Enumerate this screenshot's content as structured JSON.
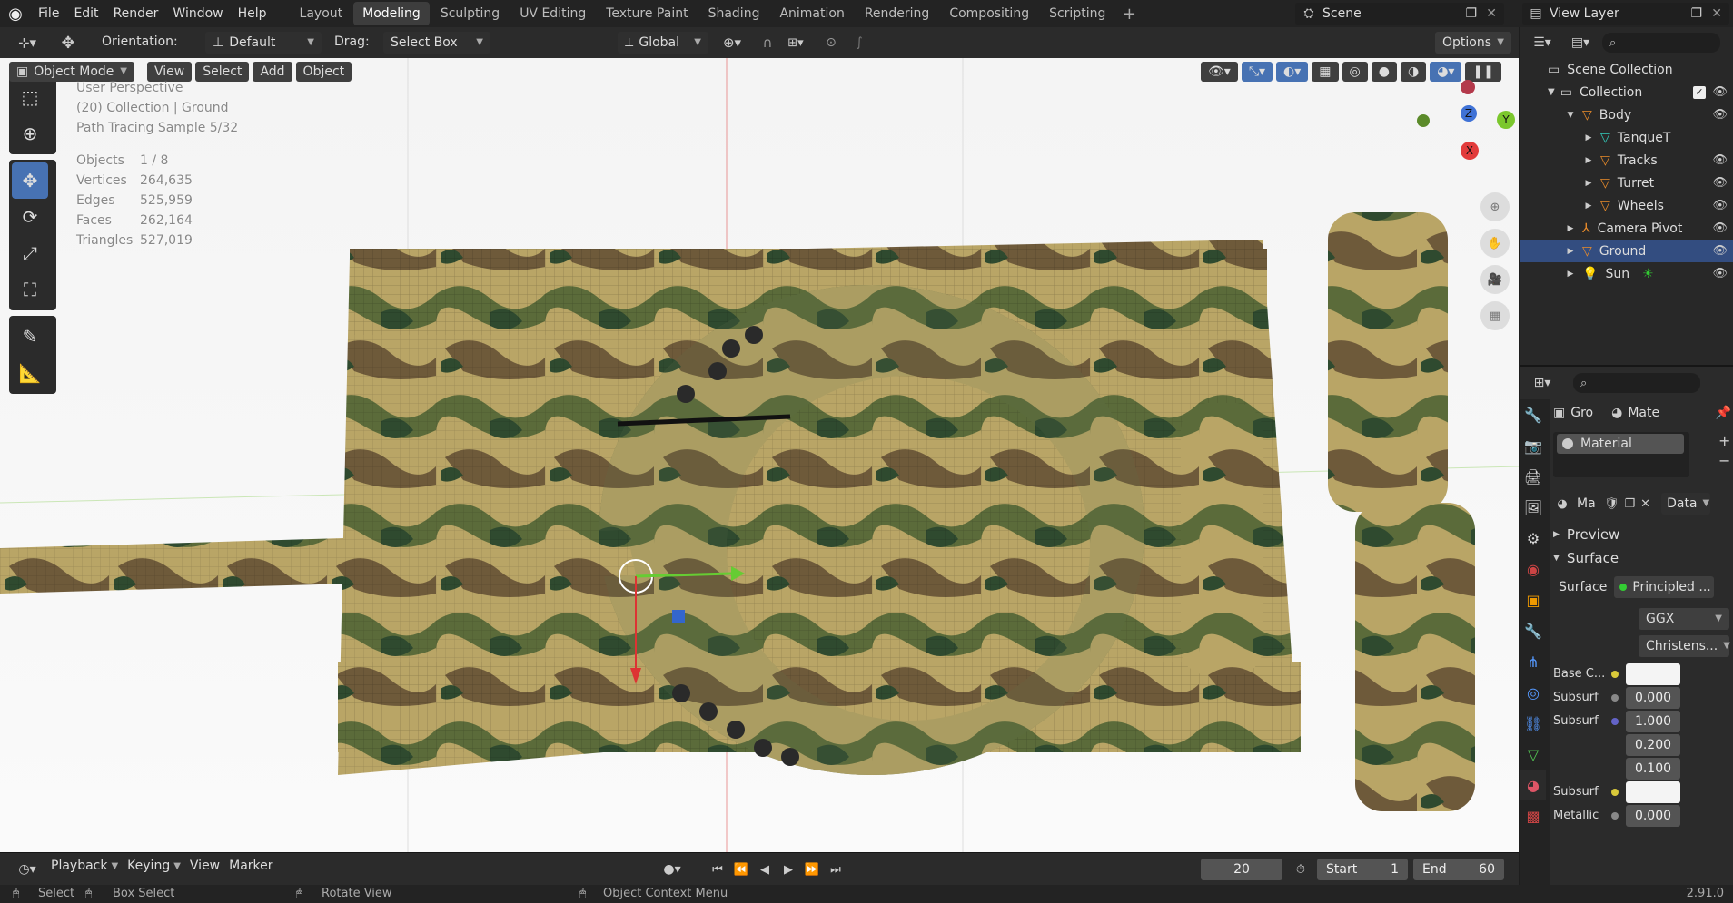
{
  "menus": [
    "File",
    "Edit",
    "Render",
    "Window",
    "Help"
  ],
  "workspaces": [
    "Layout",
    "Modeling",
    "Sculpting",
    "UV Editing",
    "Texture Paint",
    "Shading",
    "Animation",
    "Rendering",
    "Compositing",
    "Scripting"
  ],
  "active_workspace": "Modeling",
  "scene": {
    "label": "Scene"
  },
  "view_layer": {
    "label": "View Layer"
  },
  "toolbar": {
    "orientation_label": "Orientation:",
    "orientation_value": "Default",
    "drag_label": "Drag:",
    "drag_value": "Select Box",
    "transform_value": "Global",
    "options_label": "Options"
  },
  "header": {
    "mode": "Object Mode",
    "menus": [
      "View",
      "Select",
      "Add",
      "Object"
    ]
  },
  "overlay": {
    "perspective": "User Perspective",
    "collection": "(20) Collection | Ground",
    "sample": "Path Tracing Sample 5/32",
    "stats": [
      {
        "label": "Objects",
        "value": "1 / 8"
      },
      {
        "label": "Vertices",
        "value": "264,635"
      },
      {
        "label": "Edges",
        "value": "525,959"
      },
      {
        "label": "Faces",
        "value": "262,164"
      },
      {
        "label": "Triangles",
        "value": "527,019"
      }
    ]
  },
  "gizmo": {
    "z": "Z",
    "y": "Y",
    "x": "X"
  },
  "outliner": {
    "root": "Scene Collection",
    "collection": "Collection",
    "items": [
      {
        "name": "Body",
        "level": 2,
        "icon": "mesh",
        "eye": true
      },
      {
        "name": "TanqueT",
        "level": 3,
        "icon": "vertex",
        "eye": false
      },
      {
        "name": "Tracks",
        "level": 3,
        "icon": "mesh",
        "eye": true
      },
      {
        "name": "Turret",
        "level": 3,
        "icon": "mesh",
        "eye": true
      },
      {
        "name": "Wheels",
        "level": 3,
        "icon": "mesh",
        "eye": true
      },
      {
        "name": "Camera Pivot",
        "level": 2,
        "icon": "empty",
        "eye": true
      },
      {
        "name": "Ground",
        "level": 2,
        "icon": "mesh",
        "eye": true,
        "selected": true
      },
      {
        "name": "Sun",
        "level": 2,
        "icon": "light",
        "eye": true
      }
    ]
  },
  "properties": {
    "object_short": "Gro",
    "material_short": "Mate",
    "slot": "Material",
    "mat_name": "Ma",
    "data_label": "Data",
    "preview": "Preview",
    "surface": "Surface",
    "surface_label": "Surface",
    "surface_value": "Principled ...",
    "distribution": "GGX",
    "subsurface_method": "Christens...",
    "rows": [
      {
        "label": "Base C...",
        "value": "",
        "color": "#f4f4f4",
        "dot": "#d9c93a"
      },
      {
        "label": "Subsurf",
        "value": "0.000",
        "dot": "#888"
      },
      {
        "label": "Subsurf",
        "value": "1.000",
        "dot": "#6363c7"
      },
      {
        "label": "",
        "value": "0.200"
      },
      {
        "label": "",
        "value": "0.100"
      },
      {
        "label": "Subsurf",
        "value": "",
        "color": "#f4f4f4",
        "dot": "#d9c93a"
      },
      {
        "label": "Metallic",
        "value": "0.000",
        "dot": "#888"
      }
    ]
  },
  "timeline": {
    "menus": [
      "Playback",
      "Keying",
      "View",
      "Marker"
    ],
    "frame": "20",
    "start_label": "Start",
    "start": "1",
    "end_label": "End",
    "end": "60"
  },
  "status": {
    "select": "Select",
    "box_select": "Box Select",
    "rotate": "Rotate View",
    "context": "Object Context Menu",
    "version": "2.91.0"
  }
}
